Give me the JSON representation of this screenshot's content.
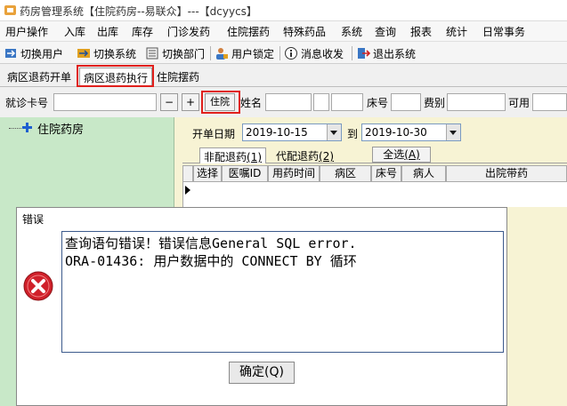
{
  "window": {
    "title": "药房管理系统【住院药房--易联众】---【dcyycs】"
  },
  "menu": {
    "items": [
      "用户操作",
      "入库",
      "出库",
      "库存",
      "门诊发药",
      "住院摆药",
      "特殊药品",
      "系统",
      "查询",
      "报表",
      "统计",
      "日常事务"
    ]
  },
  "toolbar": {
    "switch_user": "切换用户",
    "switch_system": "切换系统",
    "switch_dept": "切换部门",
    "lock_user": "用户锁定",
    "messages": "消息收发",
    "exit": "退出系统"
  },
  "tabs": {
    "items": [
      "病区退药开单",
      "病区退药执行",
      "住院摆药"
    ],
    "active_index": 1
  },
  "filters": {
    "card_label": "就诊卡号",
    "minus": "−",
    "plus": "+",
    "inpatient_button": "住院",
    "name_label": "姓名",
    "bed_label": "床号",
    "fee_label": "费别",
    "available_label": "可用"
  },
  "tree": {
    "root": "住院药房"
  },
  "query": {
    "date_label": "开单日期",
    "from_date": "2019-10-15",
    "to_label": "到",
    "to_date": "2019-10-30"
  },
  "subtabs": {
    "non_delivery": "非配退药",
    "non_delivery_key": "(1)",
    "proxy": "代配退药",
    "proxy_key": "(2)",
    "select_all": "全选",
    "select_all_key": "(A)"
  },
  "grid": {
    "columns": [
      "选择",
      "医嘱ID",
      "用药时间",
      "病区",
      "床号",
      "病人",
      "出院带药"
    ]
  },
  "dialog": {
    "title": "错误",
    "line1": "查询语句错误！错误信息General SQL error.",
    "line2": "ORA-01436: 用户数据中的 CONNECT BY 循环",
    "ok_label": "确定(Q)"
  },
  "colors": {
    "tree_bg": "#c8e8c8",
    "panel_bg": "#f7f3d4",
    "highlight": "#e0201c",
    "error_icon": "#d0202a"
  }
}
